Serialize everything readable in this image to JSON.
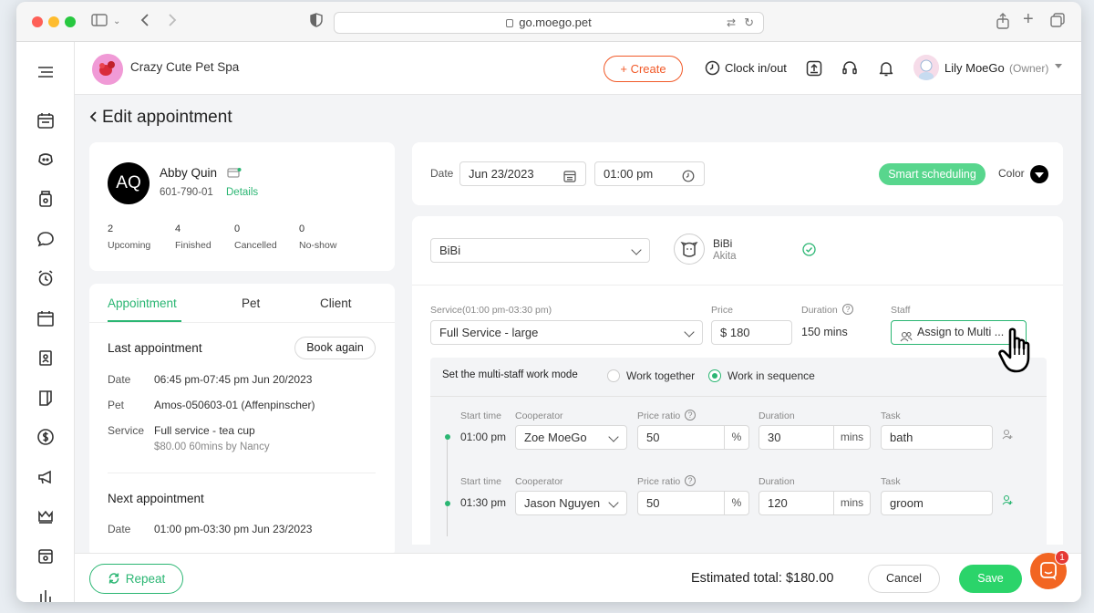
{
  "browser": {
    "url": "go.moego.pet"
  },
  "header": {
    "business_name": "Crazy Cute Pet Spa",
    "create_label": "Create",
    "clock_label": "Clock in/out",
    "user_name": "Lily MoeGo",
    "user_role": "(Owner)"
  },
  "page": {
    "title": "Edit appointment"
  },
  "client": {
    "initials": "AQ",
    "name": "Abby Quin",
    "phone": "601-790-01",
    "details_link": "Details",
    "stats": [
      {
        "value": "2",
        "label": "Upcoming"
      },
      {
        "value": "4",
        "label": "Finished"
      },
      {
        "value": "0",
        "label": "Cancelled"
      },
      {
        "value": "0",
        "label": "No-show"
      }
    ]
  },
  "tabs": {
    "appointment": "Appointment",
    "pet": "Pet",
    "client": "Client"
  },
  "last_appointment": {
    "heading": "Last appointment",
    "book_again": "Book again",
    "date_label": "Date",
    "date_value": "06:45 pm-07:45 pm Jun 20/2023",
    "pet_label": "Pet",
    "pet_value": "Amos-050603-01 (Affenpinscher)",
    "service_label": "Service",
    "service_value": "Full service - tea cup",
    "service_meta": "$80.00  60mins by Nancy"
  },
  "next_appointment": {
    "heading": "Next appointment",
    "date_label": "Date",
    "date_value": "01:00 pm-03:30 pm Jun 23/2023"
  },
  "schedule": {
    "date_label": "Date",
    "date_value": "Jun 23/2023",
    "time_value": "01:00 pm",
    "smart_scheduling": "Smart scheduling",
    "color_label": "Color"
  },
  "pet_select": {
    "value": "BiBi",
    "pet_name": "BiBi",
    "pet_breed": "Akita"
  },
  "service": {
    "service_label": "Service(01:00 pm-03:30 pm)",
    "service_value": "Full Service - large",
    "price_label": "Price",
    "price_value": "$ 180",
    "duration_label": "Duration",
    "duration_value": "150 mins",
    "staff_label": "Staff",
    "staff_value": "Assign to Multi ..."
  },
  "multi_staff": {
    "heading": "Set the multi-staff work mode",
    "option_together": "Work together",
    "option_sequence": "Work in sequence",
    "selected": "Work in sequence"
  },
  "rows_labels": {
    "start": "Start time",
    "cooperator": "Cooperator",
    "ratio": "Price ratio",
    "duration": "Duration",
    "task": "Task",
    "pct": "%",
    "mins": "mins"
  },
  "rows": [
    {
      "start": "01:00 pm",
      "cooperator": "Zoe MoeGo",
      "ratio": "50",
      "duration": "30",
      "task": "bath"
    },
    {
      "start": "01:30 pm",
      "cooperator": "Jason Nguyen",
      "ratio": "50",
      "duration": "120",
      "task": "groom"
    }
  ],
  "footer": {
    "repeat": "Repeat",
    "estimated_total": "Estimated total: $180.00",
    "cancel": "Cancel",
    "save": "Save",
    "chat_badge": "1"
  },
  "colors": {
    "accent_green": "#2bb673",
    "orange": "#f15a29",
    "smart_green": "#58d68d"
  }
}
